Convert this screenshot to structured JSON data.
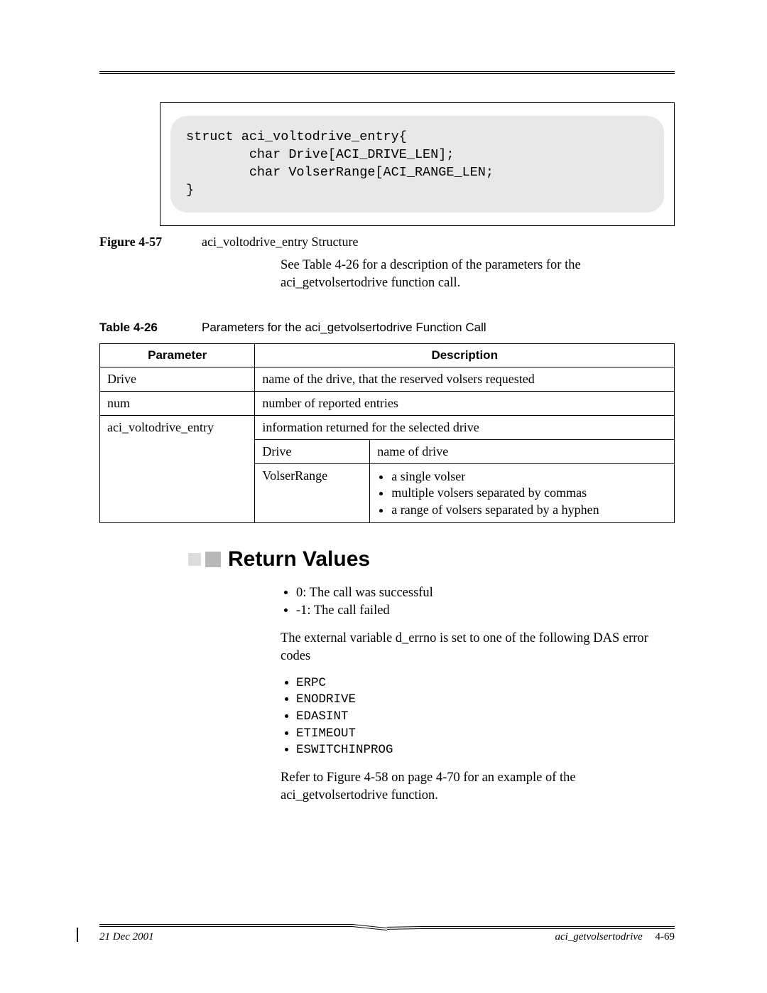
{
  "code_block": "struct aci_voltodrive_entry{\n        char Drive[ACI_DRIVE_LEN];\n        char VolserRange[ACI_RANGE_LEN;\n}",
  "figure": {
    "label": "Figure 4-57",
    "caption": "aci_voltodrive_entry Structure"
  },
  "intro_para": "See Table 4-26 for a description of the parameters for the aci_getvolsertodrive function call.",
  "table_title": {
    "label": "Table 4-26",
    "caption": "Parameters for the aci_getvolsertodrive Function Call"
  },
  "table": {
    "headers": {
      "param": "Parameter",
      "desc": "Description"
    },
    "rows": {
      "r1": {
        "param": "Drive",
        "desc": "name of the drive, that the reserved volsers requested"
      },
      "r2": {
        "param": "num",
        "desc": "number of reported entries"
      },
      "r3": {
        "param": "aci_voltodrive_entry",
        "desc": "information returned for the selected drive"
      },
      "r3a": {
        "k": "Drive",
        "v": "name of drive"
      },
      "r3b": {
        "k": "VolserRange",
        "items": {
          "i1": "a single volser",
          "i2": "multiple volsers separated by commas",
          "i3": "a range of volsers separated by a hyphen"
        }
      }
    }
  },
  "section_heading": "Return Values",
  "return_values": {
    "items": {
      "i1": "0: The call was successful",
      "i2": "-1: The call failed"
    },
    "para1": "The external variable d_errno is set to one of the following DAS error codes",
    "codes": {
      "c1": "ERPC",
      "c2": "ENODRIVE",
      "c3": "EDASINT",
      "c4": "ETIMEOUT",
      "c5": "ESWITCHINPROG"
    },
    "para2": "Refer to Figure 4-58 on page 4-70 for an example of the aci_getvolsertodrive function."
  },
  "footer": {
    "date": "21 Dec 2001",
    "func": "aci_getvolsertodrive",
    "page": "4-69"
  }
}
